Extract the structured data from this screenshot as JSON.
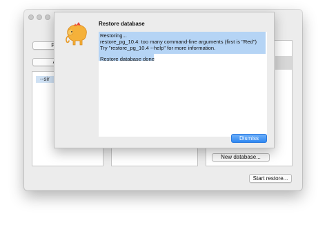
{
  "main_window": {
    "partial_button_1": "Po",
    "partial_button_2": "A",
    "list_item": "--sir",
    "new_database_label": "New database...",
    "start_restore_label": "Start restore..."
  },
  "sheet": {
    "title": "Restore database",
    "log_lines": [
      "Restoring...",
      "restore_pg_10.4: too many command-line arguments (first is \"Red\")",
      "Try \"restore_pg_10.4 --help\" for more information.",
      "",
      "Restore database done"
    ],
    "dismiss_label": "Dismiss",
    "app_icon": "elephant-icon"
  }
}
